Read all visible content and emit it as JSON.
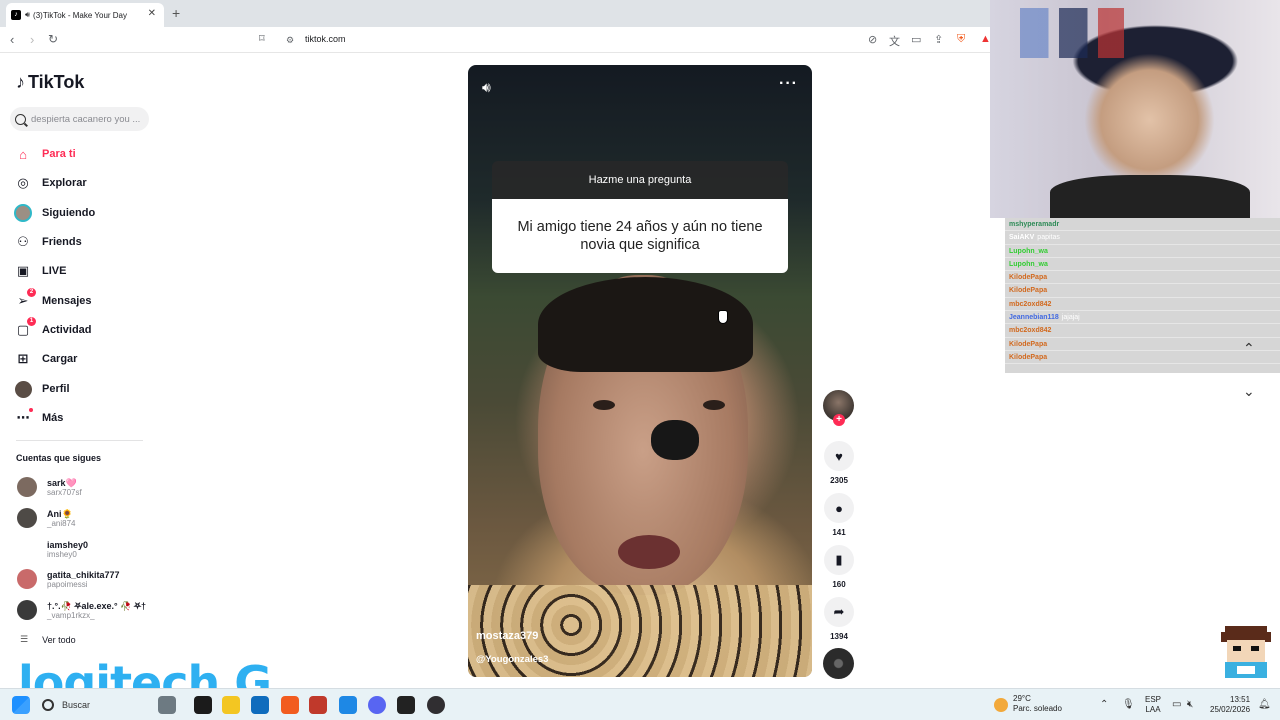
{
  "browser": {
    "tab_title": "(3)TikTok - Make Your Day",
    "url": "tiktok.com"
  },
  "sidebar": {
    "logo_text": "TikTok",
    "search_placeholder": "despierta cacanero you ...",
    "nav": [
      {
        "label": "Para ti",
        "icon": "home-icon",
        "active": true
      },
      {
        "label": "Explorar",
        "icon": "compass-icon"
      },
      {
        "label": "Siguiendo",
        "icon": "following-avatar-icon"
      },
      {
        "label": "Friends",
        "icon": "friends-icon"
      },
      {
        "label": "LIVE",
        "icon": "live-icon"
      },
      {
        "label": "Mensajes",
        "icon": "messages-icon",
        "badge": "2"
      },
      {
        "label": "Actividad",
        "icon": "activity-icon",
        "badge": "1"
      },
      {
        "label": "Cargar",
        "icon": "upload-icon"
      },
      {
        "label": "Perfil",
        "icon": "profile-icon"
      },
      {
        "label": "Más",
        "icon": "more-icon",
        "dot": true
      }
    ],
    "following_title": "Cuentas que sigues",
    "following": [
      {
        "name": "sark🩷",
        "handle": "sarx707sf"
      },
      {
        "name": "Ani🌻",
        "handle": "_ani874"
      },
      {
        "name": "iamshey0",
        "handle": "imshey0"
      },
      {
        "name": "gatita_chikita777",
        "handle": "papoimessi"
      },
      {
        "name": "†.°.🥀 ⛧ale.exe.° 🥀 ⛧†",
        "handle": "_vamp1rkzx_"
      }
    ],
    "see_all": "Ver todo"
  },
  "video": {
    "question_header": "Hazme una pregunta",
    "question_text": "Mi amigo tiene 24 años y aún no tiene novia que significa",
    "author_name": "mostaza379",
    "author_handle": "@Yougonzales3"
  },
  "actions": {
    "likes": "2305",
    "comments": "141",
    "saves": "160",
    "shares": "1394"
  },
  "chat": [
    {
      "user": "mshyperamadr",
      "msg": "",
      "color": "#2e8b57"
    },
    {
      "user": "SaiAKV",
      "msg": "papitas",
      "color": "#ffffff"
    },
    {
      "user": "Lupohn_wa",
      "msg": "",
      "color": "#32cd32"
    },
    {
      "user": "Lupohn_wa",
      "msg": "",
      "color": "#32cd32"
    },
    {
      "user": "KilodePapa",
      "msg": "",
      "color": "#d2691e"
    },
    {
      "user": "KilodePapa",
      "msg": "",
      "color": "#d2691e"
    },
    {
      "user": "mbc2oxd842",
      "msg": "",
      "color": "#d2691e"
    },
    {
      "user": "Jeannebian118",
      "msg": "jajajaj",
      "color": "#4169e1"
    },
    {
      "user": "mbc2oxd842",
      "msg": "",
      "color": "#d2691e"
    },
    {
      "user": "KilodePapa",
      "msg": "",
      "color": "#d2691e"
    },
    {
      "user": "KilodePapa",
      "msg": "",
      "color": "#d2691e"
    }
  ],
  "watermark": "logitech G",
  "taskbar": {
    "search_label": "Buscar",
    "temperature": "29°C",
    "weather_desc": "Parc. soleado",
    "lang_1": "ESP",
    "lang_2": "LAA",
    "time": "13:51",
    "date": "25/02/2026"
  },
  "colors": {
    "accent": "#fe2c55",
    "chat_bg": "#c8c8c8",
    "taskbar_bg": "#e8f2f6"
  }
}
